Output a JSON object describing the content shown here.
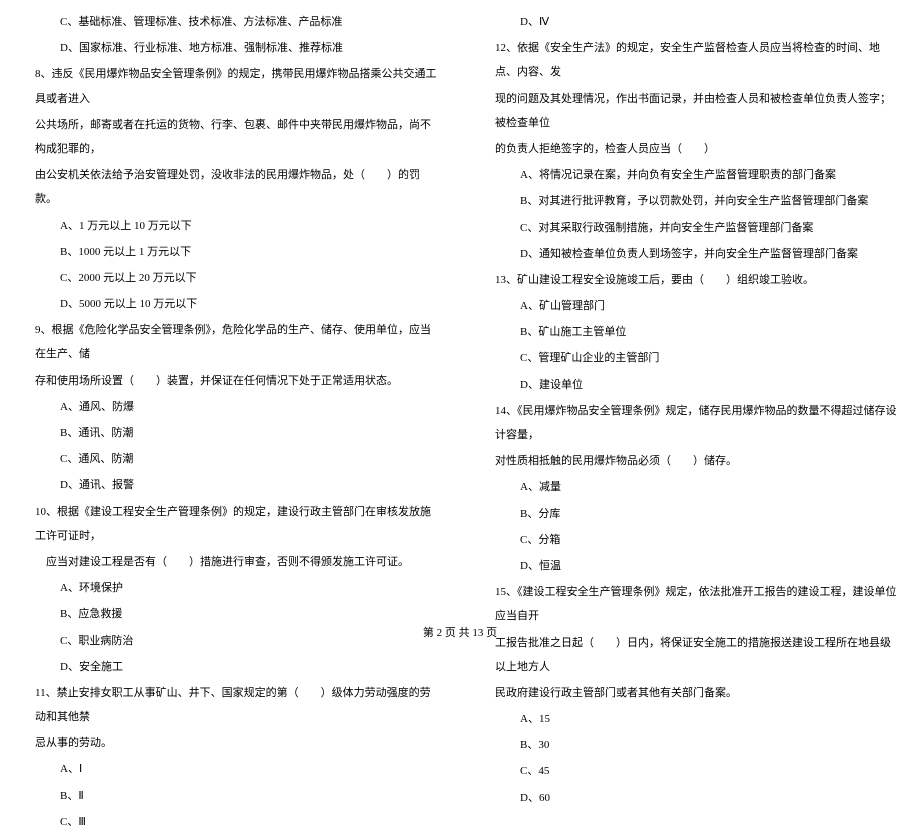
{
  "left_column": {
    "q7_options": {
      "c": "C、基础标准、管理标准、技术标准、方法标准、产品标准",
      "d": "D、国家标准、行业标准、地方标准、强制标准、推荐标准"
    },
    "q8": {
      "line1": "8、违反《民用爆炸物品安全管理条例》的规定，携带民用爆炸物品搭乘公共交通工具或者进入",
      "line2": "公共场所，邮寄或者在托运的货物、行李、包裹、邮件中夹带民用爆炸物品，尚不构成犯罪的，",
      "line3": "由公安机关依法给予治安管理处罚，没收非法的民用爆炸物品，处（　　）的罚款。",
      "a": "A、1 万元以上 10 万元以下",
      "b": "B、1000 元以上 1 万元以下",
      "c": "C、2000 元以上 20 万元以下",
      "d": "D、5000 元以上 10 万元以下"
    },
    "q9": {
      "line1": "9、根据《危险化学品安全管理条例》，危险化学品的生产、储存、使用单位，应当在生产、储",
      "line2": "存和使用场所设置（　　）装置，并保证在任何情况下处于正常适用状态。",
      "a": "A、通风、防爆",
      "b": "B、通讯、防潮",
      "c": "C、通风、防潮",
      "d": "D、通讯、报警"
    },
    "q10": {
      "line1": "10、根据《建设工程安全生产管理条例》的规定，建设行政主管部门在审核发放施工许可证时，",
      "line2": "　应当对建设工程是否有（　　）措施进行审查，否则不得颁发施工许可证。",
      "a": "A、环境保护",
      "b": "B、应急救援",
      "c": "C、职业病防治",
      "d": "D、安全施工"
    },
    "q11": {
      "line1": "11、禁止安排女职工从事矿山、井下、国家规定的第（　　）级体力劳动强度的劳动和其他禁",
      "line2": "忌从事的劳动。",
      "a": "A、Ⅰ",
      "b": "B、Ⅱ",
      "c": "C、Ⅲ"
    }
  },
  "right_column": {
    "q11_d": "D、Ⅳ",
    "q12": {
      "line1": "12、依据《安全生产法》的规定，安全生产监督检查人员应当将检查的时间、地点、内容、发",
      "line2": "现的问题及其处理情况，作出书面记录，并由检查人员和被检查单位负责人签字；被检查单位",
      "line3": "的负责人拒绝签字的，检查人员应当（　　）",
      "a": "A、将情况记录在案，并向负有安全生产监督管理职责的部门备案",
      "b": "B、对其进行批评教育，予以罚款处罚，并向安全生产监督管理部门备案",
      "c": "C、对其采取行政强制措施，并向安全生产监督管理部门备案",
      "d": "D、通知被检查单位负责人到场签字，并向安全生产监督管理部门备案"
    },
    "q13": {
      "line1": "13、矿山建设工程安全设施竣工后，要由（　　）组织竣工验收。",
      "a": "A、矿山管理部门",
      "b": "B、矿山施工主管单位",
      "c": "C、管理矿山企业的主管部门",
      "d": "D、建设单位"
    },
    "q14": {
      "line1": "14、《民用爆炸物品安全管理条例》规定，储存民用爆炸物品的数量不得超过储存设计容量，",
      "line2": "对性质相抵触的民用爆炸物品必须（　　）储存。",
      "a": "A、减量",
      "b": "B、分库",
      "c": "C、分箱",
      "d": "D、恒温"
    },
    "q15": {
      "line1": "15、《建设工程安全生产管理条例》规定，依法批准开工报告的建设工程，建设单位应当自开",
      "line2": "工报告批准之日起（　　）日内，将保证安全施工的措施报送建设工程所在地县级以上地方人",
      "line3": "民政府建设行政主管部门或者其他有关部门备案。",
      "a": "A、15",
      "b": "B、30",
      "c": "C、45",
      "d": "D、60"
    }
  },
  "footer": "第 2 页 共 13 页"
}
